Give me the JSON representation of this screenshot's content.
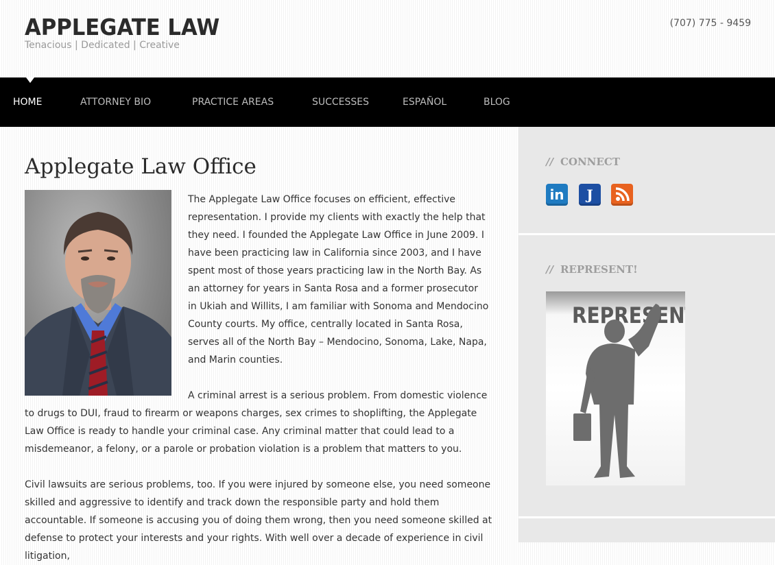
{
  "header": {
    "title": "APPLEGATE LAW",
    "tagline": "Tenacious | Dedicated | Creative",
    "phone": "(707) 775 - 9459"
  },
  "nav": {
    "items": [
      {
        "label": "HOME",
        "active": true
      },
      {
        "label": "ATTORNEY BIO",
        "active": false
      },
      {
        "label": "PRACTICE AREAS",
        "active": false
      },
      {
        "label": "SUCCESSES",
        "active": false
      },
      {
        "label": "ESPAÑOL",
        "active": false
      },
      {
        "label": "BLOG",
        "active": false
      }
    ]
  },
  "main": {
    "title": "Applegate Law Office",
    "paragraph1": "The Applegate Law Office focuses on efficient, effective representation. I provide my clients with exactly the help that they need. I founded the Applegate Law Office in June 2009. I have been practicing law in California since 2003, and I have spent most of those years practicing law in the North Bay. As an attorney for years in Santa Rosa and a former prosecutor in Ukiah and Willits, I am familiar with Sonoma and Mendocino County courts. My office, centrally located in Santa Rosa, serves all of the North Bay – Mendocino, Sonoma, Lake, Napa, and Marin counties.",
    "paragraph2": "A criminal arrest is a serious problem.  From domestic violence to drugs to DUI, fraud to firearm or weapons charges, sex crimes to shoplifting, the Applegate Law Office is ready to handle your criminal case. Any criminal matter that could lead to a misdemeanor, a felony, or a parole or probation violation is a problem that matters to you.",
    "paragraph3": "Civil lawsuits are serious problems, too. If you were injured by someone else, you need someone skilled and aggressive to identify and track down the responsible party and hold them accountable.  If someone is accusing you of doing them wrong, then you need someone skilled at defense to protect your interests and your rights. With well over a decade of experience in civil litigation,"
  },
  "sidebar": {
    "connect_title": "CONNECT",
    "represent_title": "REPRESENT!",
    "slashes": "//",
    "social": [
      {
        "icon": "linkedin-icon",
        "glyph": "in",
        "color": "#1f7bc1"
      },
      {
        "icon": "justia-icon",
        "glyph": "J",
        "color": "#1d4fa3"
      },
      {
        "icon": "rss-icon",
        "glyph": "",
        "color": "#e8621f"
      }
    ],
    "represent_image_text": "REPRESENT"
  },
  "colors": {
    "nav_bg": "#000000",
    "sidebar_bg": "#e8e8e8",
    "title": "#2b2b2b"
  }
}
